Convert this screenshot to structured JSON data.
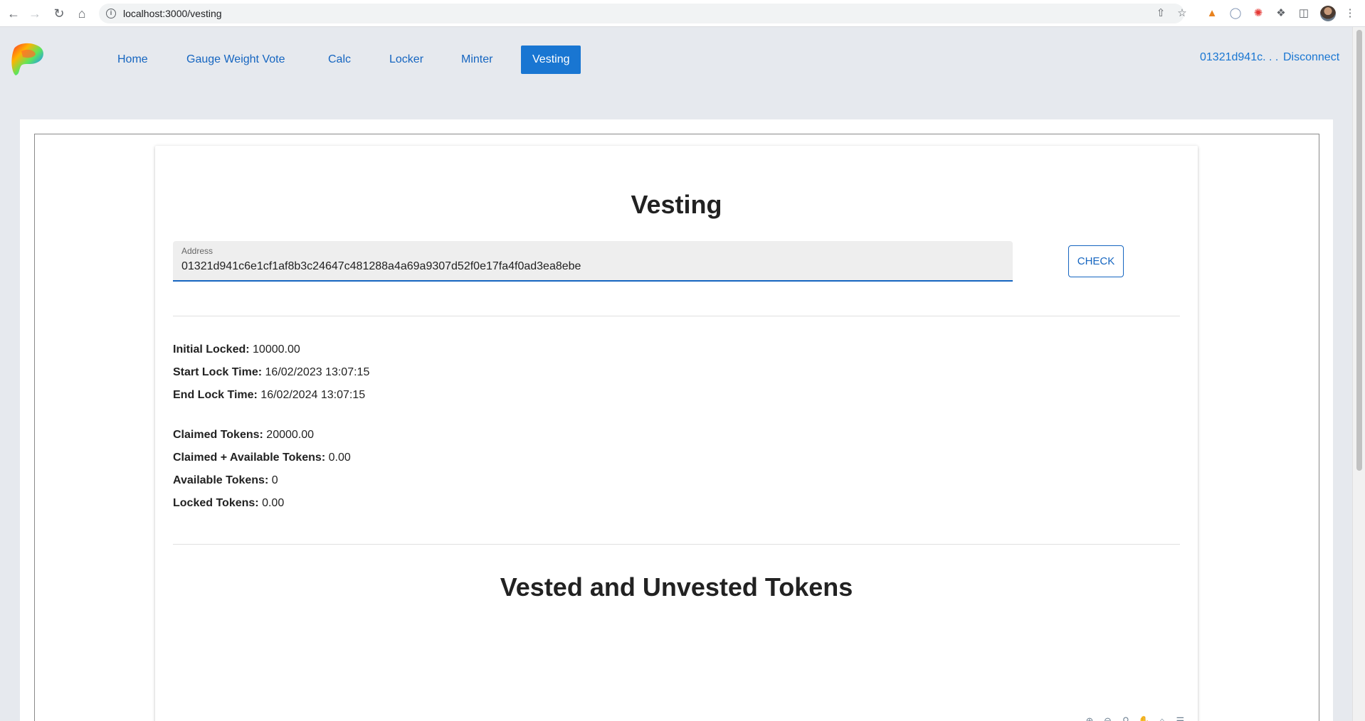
{
  "browser": {
    "url": "localhost:3000/vesting"
  },
  "header": {
    "nav": [
      {
        "label": "Home",
        "active": false
      },
      {
        "label": "Gauge Weight Vote",
        "active": false
      },
      {
        "label": "Calc",
        "active": false
      },
      {
        "label": "Locker",
        "active": false
      },
      {
        "label": "Minter",
        "active": false
      },
      {
        "label": "Vesting",
        "active": true
      }
    ],
    "account": "01321d941c. . .",
    "disconnect": "Disconnect"
  },
  "vesting": {
    "title": "Vesting",
    "address_label": "Address",
    "address_value": "01321d941c6e1cf1af8b3c24647c481288a4a69a9307d52f0e17fa4f0ad3ea8ebe",
    "check_label": "CHECK",
    "info": [
      {
        "label": "Initial Locked:",
        "value": "10000.00"
      },
      {
        "label": "Start Lock Time:",
        "value": "16/02/2023 13:07:15"
      },
      {
        "label": "End Lock Time:",
        "value": "16/02/2024 13:07:15"
      },
      {
        "label": "Claimed Tokens:",
        "value": "20000.00"
      },
      {
        "label": "Claimed + Available Tokens:",
        "value": "0.00"
      },
      {
        "label": "Available Tokens:",
        "value": "0"
      },
      {
        "label": "Locked Tokens:",
        "value": "0.00"
      }
    ],
    "chart_title": "Vested and Unvested Tokens"
  },
  "colors": {
    "accent": "#1976d2",
    "page_bg": "#e6e9ee"
  }
}
